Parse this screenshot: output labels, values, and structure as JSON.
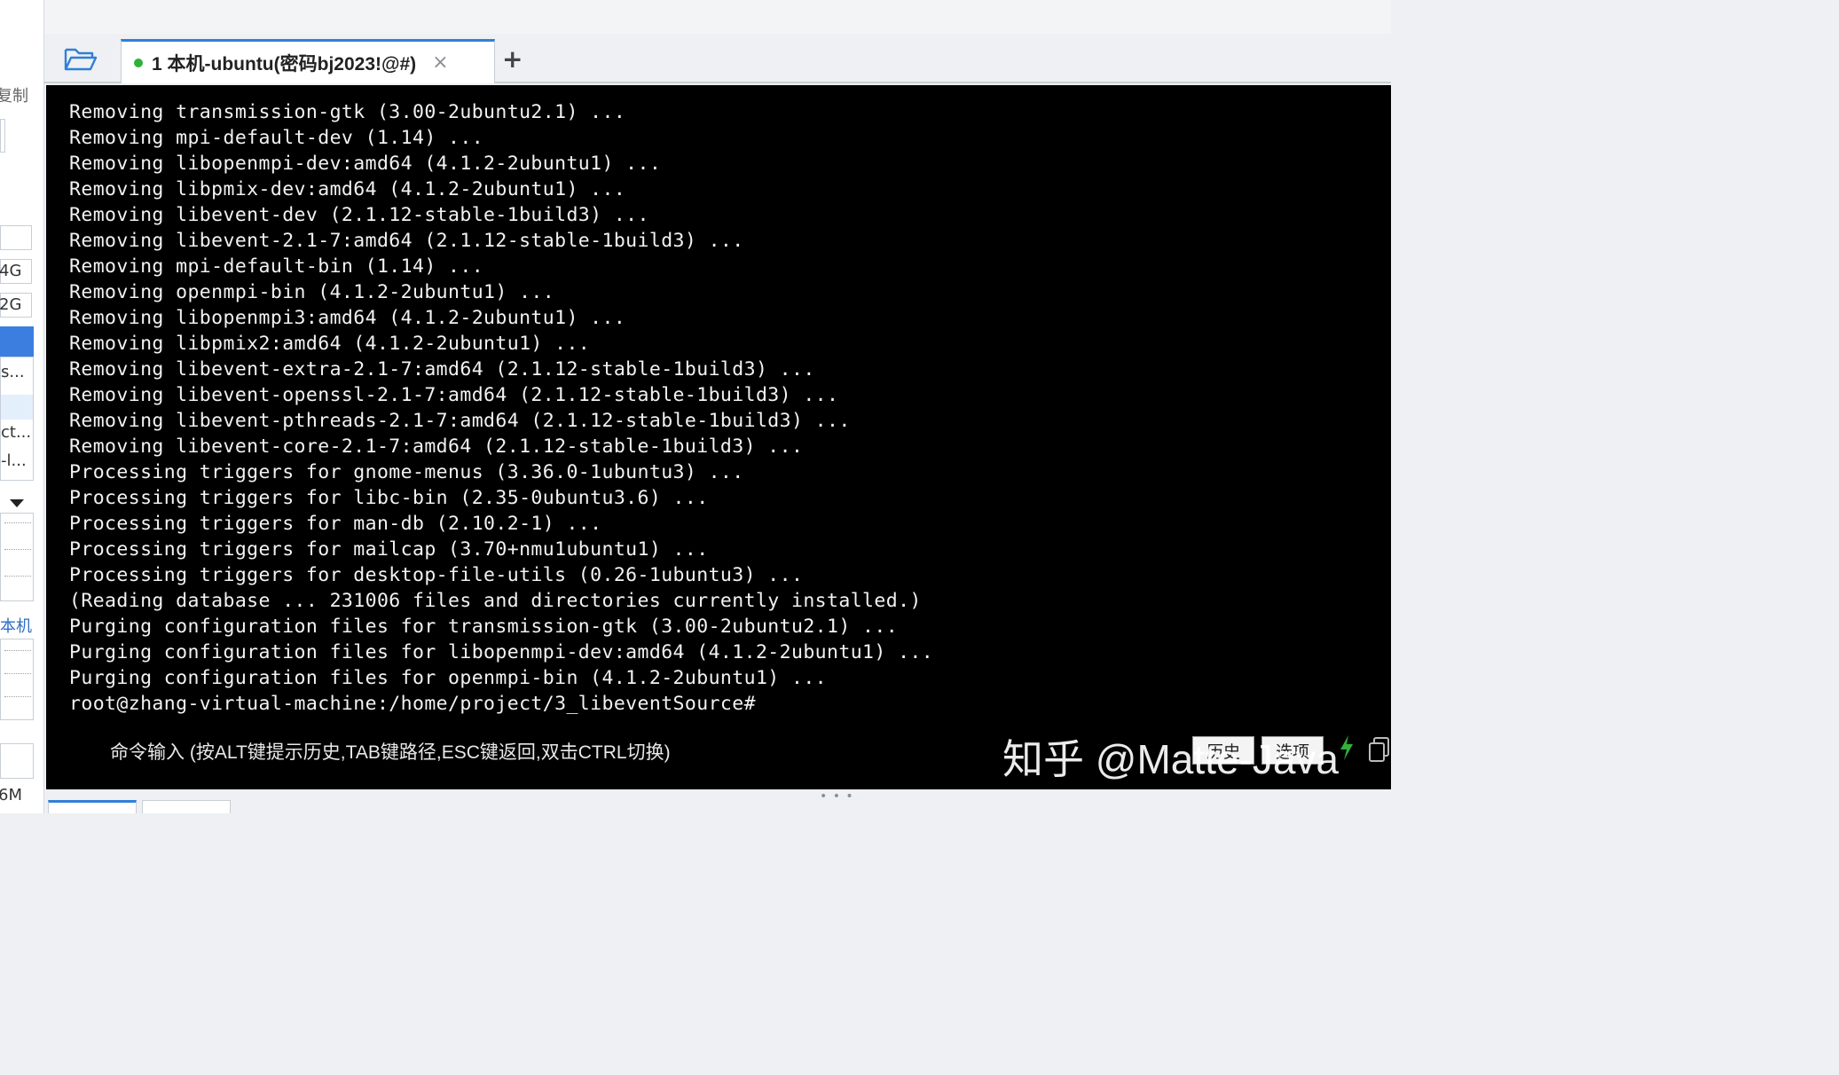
{
  "sidebar": {
    "label_copy": "复制",
    "size_a": "4G",
    "size_b": "2G",
    "item_a": "s...",
    "item_b": "ct...",
    "item_c": "-l...",
    "host_label": "本机",
    "mem_label": "6M"
  },
  "tab": {
    "title": "1 本机-ubuntu(密码bj2023!@#)",
    "close_symbol": "×",
    "add_symbol": "+"
  },
  "terminal": {
    "lines": [
      "Removing transmission-gtk (3.00-2ubuntu2.1) ...",
      "Removing mpi-default-dev (1.14) ...",
      "Removing libopenmpi-dev:amd64 (4.1.2-2ubuntu1) ...",
      "Removing libpmix-dev:amd64 (4.1.2-2ubuntu1) ...",
      "Removing libevent-dev (2.1.12-stable-1build3) ...",
      "Removing libevent-2.1-7:amd64 (2.1.12-stable-1build3) ...",
      "Removing mpi-default-bin (1.14) ...",
      "Removing openmpi-bin (4.1.2-2ubuntu1) ...",
      "Removing libopenmpi3:amd64 (4.1.2-2ubuntu1) ...",
      "Removing libpmix2:amd64 (4.1.2-2ubuntu1) ...",
      "Removing libevent-extra-2.1-7:amd64 (2.1.12-stable-1build3) ...",
      "Removing libevent-openssl-2.1-7:amd64 (2.1.12-stable-1build3) ...",
      "Removing libevent-pthreads-2.1-7:amd64 (2.1.12-stable-1build3) ...",
      "Removing libevent-core-2.1-7:amd64 (2.1.12-stable-1build3) ...",
      "Processing triggers for gnome-menus (3.36.0-1ubuntu3) ...",
      "Processing triggers for libc-bin (2.35-0ubuntu3.6) ...",
      "Processing triggers for man-db (2.10.2-1) ...",
      "Processing triggers for mailcap (3.70+nmu1ubuntu1) ...",
      "Processing triggers for desktop-file-utils (0.26-1ubuntu3) ...",
      "(Reading database ... 231006 files and directories currently installed.)",
      "Purging configuration files for transmission-gtk (3.00-2ubuntu2.1) ...",
      "Purging configuration files for libopenmpi-dev:amd64 (4.1.2-2ubuntu1) ...",
      "Purging configuration files for openmpi-bin (4.1.2-2ubuntu1) ...",
      "root@zhang-virtual-machine:/home/project/3_libeventSource#"
    ],
    "command_hint": "命令输入 (按ALT键提示历史,TAB键路径,ESC键返回,双击CTRL切换)",
    "history_button": "历史",
    "options_button": "选项",
    "watermark": "知乎 @Matte-Java"
  },
  "colors": {
    "accent": "#2f7fd8",
    "status_green": "#2fb13a",
    "terminal_bg": "#000000",
    "terminal_fg": "#f2f2f2"
  }
}
